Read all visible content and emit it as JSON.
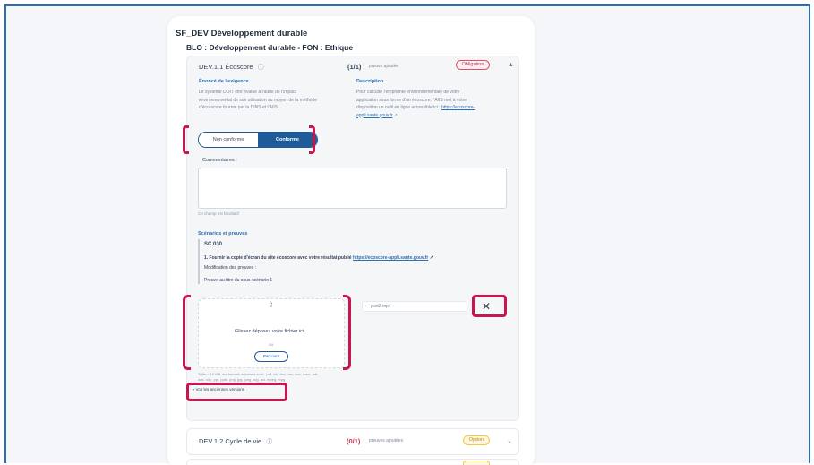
{
  "header": {
    "title": "SF_DEV Développement durable",
    "subtitle": "BLO : Développement durable - FON : Ethique"
  },
  "requirement": {
    "title": "DEV.1.1 Écoscore",
    "score": "(1/1)",
    "score_sub": "preuve ajoutée",
    "badge": "Obligation",
    "statement_heading": "Énoncé de l'exigence",
    "statement_lines": [
      "Le système DOIT être évalué à l'aune de l'impact",
      "environnemental de son utilisation au moyen de la méthode",
      "d'éco-score fournie par la DINS et l'AIIS"
    ],
    "description_heading": "Description",
    "description_lines": [
      "Pour calculer l'empreinte environnementale de votre",
      "application sous forme d'un écoscore, l'AIIS met à votre",
      "disposition un outil en ligne accessible ici :"
    ],
    "description_link": "https://ecoscore-appli.sante.gouv.fr",
    "toggle": {
      "off_label": "Non conforme",
      "on_label": "Conforme"
    },
    "comment_label": "Commentaires :",
    "comment_helper": "Ce champ est facultatif",
    "scenarios_heading": "Scénarios et preuves",
    "scenario_code": "SC.030",
    "scenario_step": "1. Fournir la copie d'écran du site écoscore avec votre résultat publié",
    "scenario_link": "https://ecoscore-appli.sante.gouv.fr",
    "scenario_modif": "Modification des preuves :",
    "proof_label": "Preuve au titre du sous-scénario 1",
    "dropzone": {
      "text": "Glissez déposez votre fichier ici",
      "or": "ou",
      "button": "Parcourir",
      "help_lines": [
        "Taille < 10 MB, les formats autorisés sont : pdf, xls, xlsx, csv, doc, docx, odt,",
        "ods, odp, ppt, pptx, png, jpg, jpeg, svg, avi, mpeg, mpg"
      ]
    },
    "file_name": "part2.mp4",
    "old_versions": "Voir les anciennes versions"
  },
  "next_requirement": {
    "title": "DEV.1.2 Cycle de vie",
    "score": "(0/1)",
    "score_sub": "preuves ajoutées",
    "badge": "Option"
  },
  "icons": {
    "info": "info-circle-icon",
    "chevron_up": "chevron-up-icon",
    "chevron_down": "chevron-down-icon",
    "upload": "upload-icon",
    "close": "close-icon",
    "external_link": "external-link-icon"
  },
  "colors": {
    "primary": "#1f5a99",
    "link": "#2f6fb3",
    "highlight": "#c8174f",
    "obligation": "#c23452",
    "option": "#f0c94a"
  }
}
